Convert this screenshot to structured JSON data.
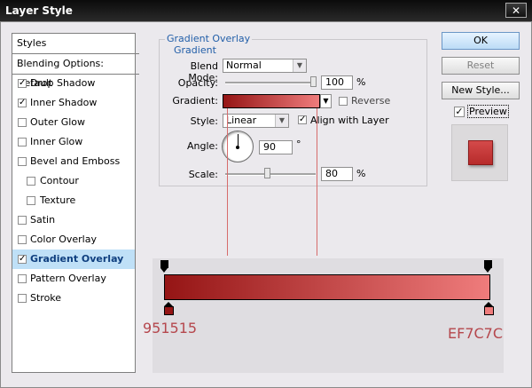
{
  "window": {
    "title": "Layer Style",
    "close_glyph": "✕"
  },
  "styles_list": {
    "header": "Styles",
    "blending": "Blending Options: Default",
    "items": [
      {
        "label": "Drop Shadow",
        "checked": true
      },
      {
        "label": "Inner Shadow",
        "checked": true
      },
      {
        "label": "Outer Glow",
        "checked": false
      },
      {
        "label": "Inner Glow",
        "checked": false
      },
      {
        "label": "Bevel and Emboss",
        "checked": false
      },
      {
        "label": "Contour",
        "checked": false
      },
      {
        "label": "Texture",
        "checked": false
      },
      {
        "label": "Satin",
        "checked": false
      },
      {
        "label": "Color Overlay",
        "checked": false
      },
      {
        "label": "Gradient Overlay",
        "checked": true,
        "selected": true
      },
      {
        "label": "Pattern Overlay",
        "checked": false
      },
      {
        "label": "Stroke",
        "checked": false
      }
    ]
  },
  "buttons": {
    "ok": "OK",
    "reset": "Reset",
    "new_style": "New Style...",
    "preview": "Preview",
    "preview_checked": true
  },
  "gradient_overlay": {
    "title": "Gradient Overlay",
    "subtitle": "Gradient",
    "blend_mode_label": "Blend Mode:",
    "blend_mode_value": "Normal",
    "opacity_label": "Opacity:",
    "opacity_value": "100",
    "opacity_unit": "%",
    "opacity_level": 1.0,
    "gradient_label": "Gradient:",
    "reverse_label": "Reverse",
    "reverse_checked": false,
    "style_label": "Style:",
    "style_value": "Linear",
    "align_label": "Align with Layer",
    "align_checked": true,
    "angle_label": "Angle:",
    "angle_value": "90",
    "angle_unit": "°",
    "scale_label": "Scale:",
    "scale_value": "80",
    "scale_unit": "%",
    "scale_level": 0.8
  },
  "gradient_editor": {
    "start_color_label": "951515",
    "end_color_label": "EF7C7C",
    "start_color": "#951515",
    "end_color": "#ef7c7c"
  },
  "colors": {
    "selection_bg": "#bfe0f7",
    "accent_text": "#215ea8",
    "hex_label_color": "#b5474d"
  }
}
